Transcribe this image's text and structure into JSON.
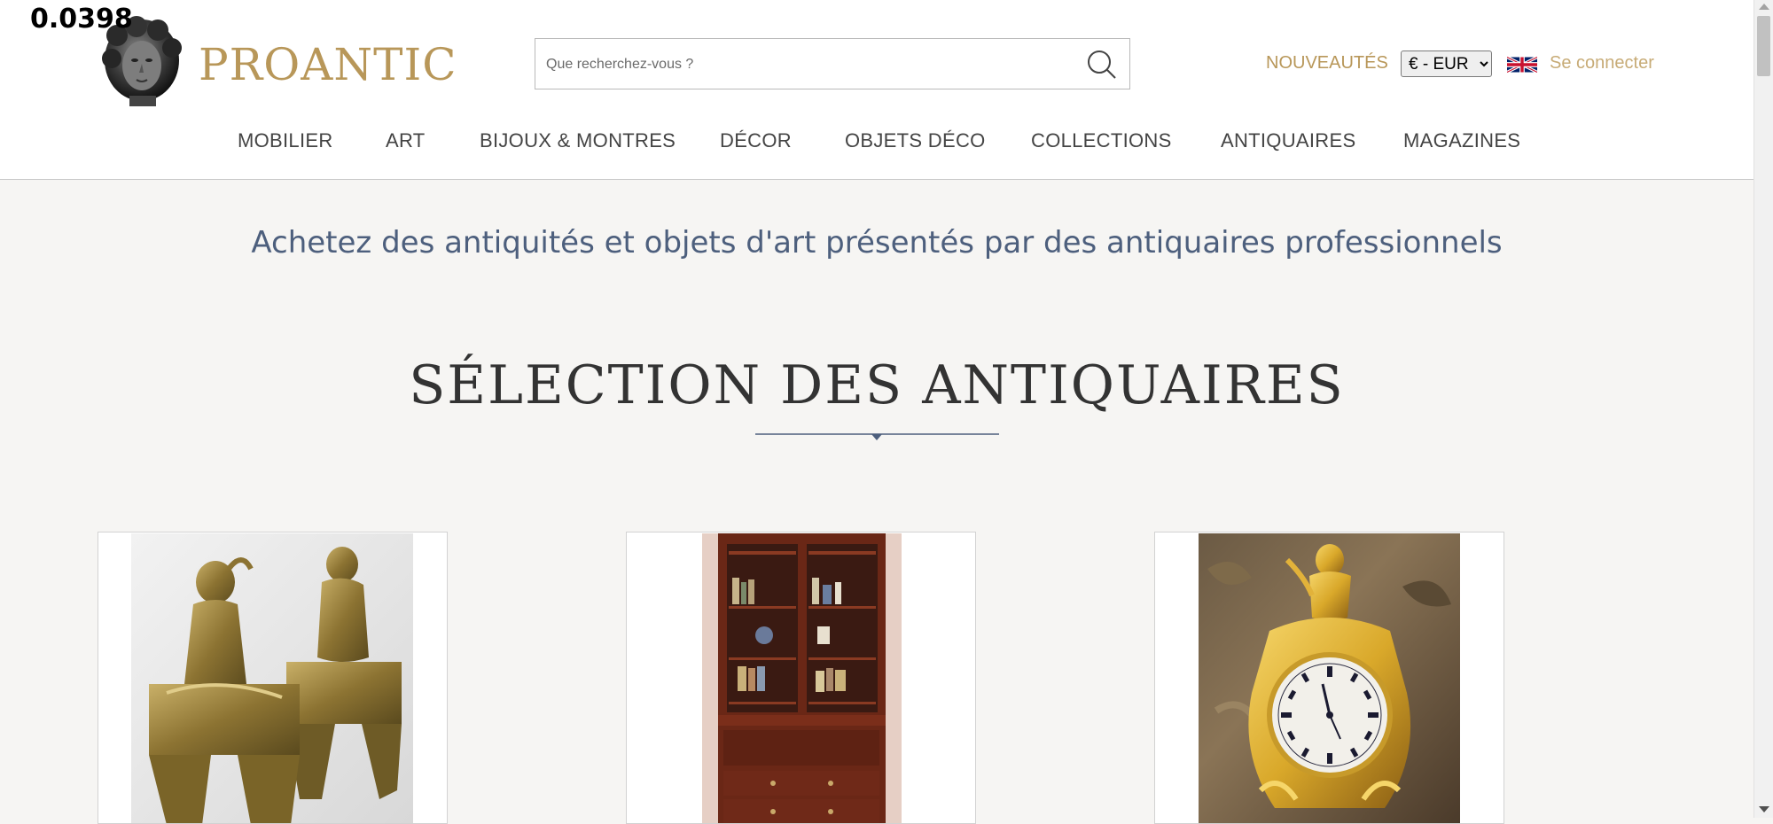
{
  "debug_value": "0.0398",
  "brand": {
    "name": "PROANTIC",
    "color": "#b89759"
  },
  "search": {
    "placeholder": "Que recherchez-vous ?",
    "value": ""
  },
  "header": {
    "nouveautes": "NOUVEAUTÉS",
    "currency": "€ - EUR",
    "login": "Se connecter"
  },
  "nav": [
    "MOBILIER",
    "ART",
    "BIJOUX & MONTRES",
    "DÉCOR",
    "OBJETS DÉCO",
    "COLLECTIONS",
    "ANTIQUAIRES",
    "MAGAZINES"
  ],
  "tagline": "Achetez des antiquités et objets d'art présentés par des antiquaires professionnels",
  "section_title": "SÉLECTION DES ANTIQUAIRES",
  "icons": [
    "search-icon",
    "uk-flag-icon",
    "logo-head-icon"
  ],
  "colors": {
    "tagline": "#4d5f7d",
    "gold": "#b89759",
    "background": "#f6f5f3"
  }
}
